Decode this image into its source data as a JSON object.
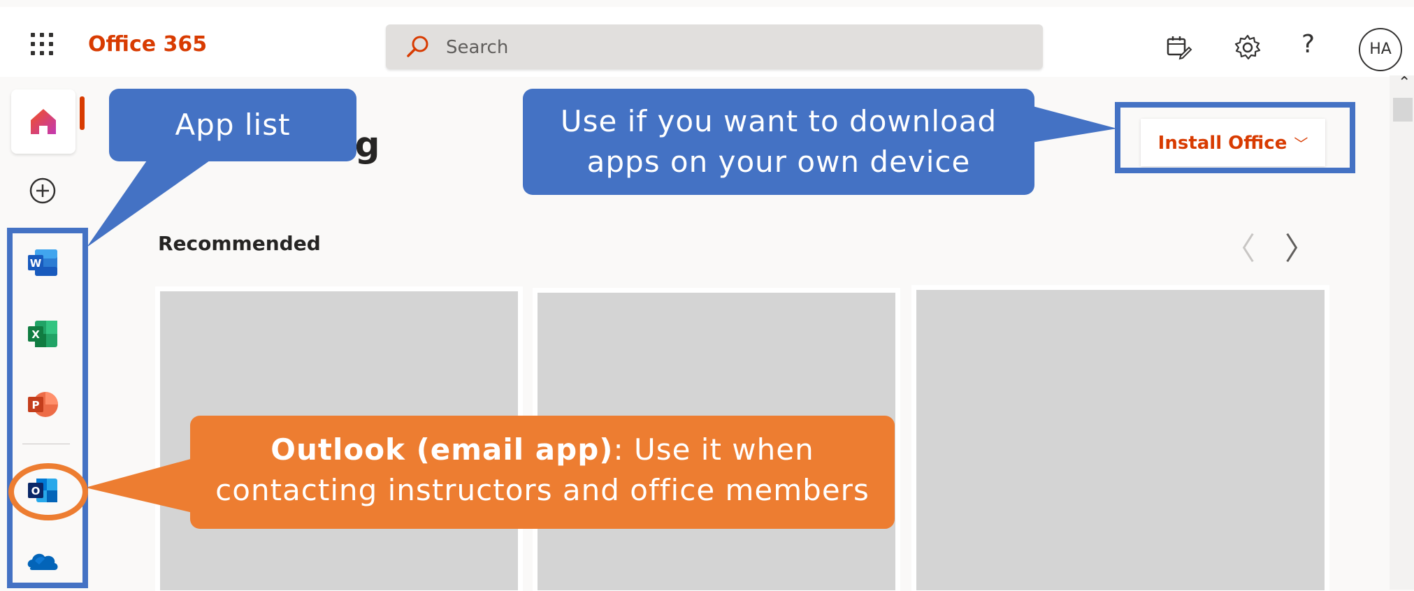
{
  "header": {
    "app_name": "Office 365",
    "search_placeholder": "Search",
    "avatar_initials": "HA",
    "help_glyph": "?",
    "icons": [
      "waffle-icon",
      "search-icon",
      "calendar-check-icon",
      "gear-icon",
      "help-icon"
    ]
  },
  "rail": {
    "items": [
      {
        "name": "home",
        "icon": "home-icon"
      },
      {
        "name": "create",
        "icon": "plus-circle-icon"
      },
      {
        "name": "word",
        "icon": "word-icon",
        "letter": "W"
      },
      {
        "name": "excel",
        "icon": "excel-icon",
        "letter": "X"
      },
      {
        "name": "powerpoint",
        "icon": "powerpoint-icon",
        "letter": "P"
      },
      {
        "name": "outlook",
        "icon": "outlook-icon",
        "letter": "O"
      },
      {
        "name": "onedrive",
        "icon": "onedrive-icon"
      }
    ]
  },
  "main": {
    "greeting_partial": "ng",
    "recommended_title": "Recommended",
    "prev_glyph": "〈",
    "next_glyph": "〉",
    "install_label": "Install Office",
    "install_chevron": "﹀"
  },
  "annotations": {
    "app_list": "App list",
    "install_note": "Use if you want to download apps on your own device",
    "outlook_bold": "Outlook (email app)",
    "outlook_rest": ": Use it  when contacting  instructors and office members"
  },
  "colors": {
    "brand": "#d83b01",
    "callout_blue": "#4472c4",
    "callout_orange": "#ed7d31"
  }
}
